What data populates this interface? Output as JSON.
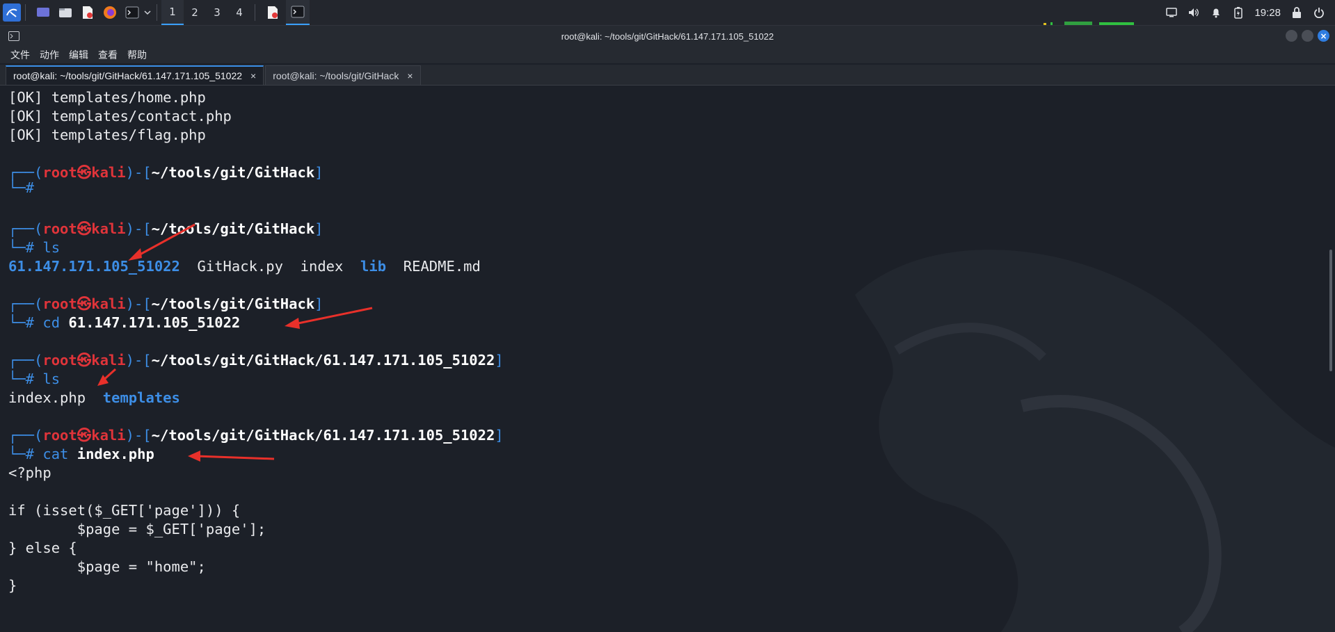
{
  "taskbar": {
    "workspaces": [
      "1",
      "2",
      "3",
      "4"
    ],
    "active_workspace": "1",
    "clock": "19:28",
    "icons": [
      "kali-menu-icon",
      "desktop-icon",
      "file-manager-icon",
      "text-editor-icon",
      "firefox-icon",
      "terminal-icon",
      "dropdown-icon"
    ],
    "tray_icons": [
      "display-icon",
      "volume-icon",
      "notification-bell-icon",
      "battery-icon",
      "lock-icon",
      "power-icon"
    ]
  },
  "window": {
    "title": "root@kali: ~/tools/git/GitHack/61.147.171.105_51022"
  },
  "menu": [
    "文件",
    "动作",
    "编辑",
    "查看",
    "帮助"
  ],
  "tabs": [
    {
      "label": "root@kali: ~/tools/git/GitHack/61.147.171.105_51022",
      "close": "×"
    },
    {
      "label": "root@kali: ~/tools/git/GitHack",
      "close": "×"
    }
  ],
  "terminal": {
    "ok1": "[OK] templates/home.php",
    "ok2": "[OK] templates/contact.php",
    "ok3": "[OK] templates/flag.php",
    "prompt_open": "┌──(",
    "prompt_user": "root㉿kali",
    "prompt_mid": ")-[",
    "prompt_close": "]",
    "prompt_hash": "└─#",
    "path_githack": "~/tools/git/GitHack",
    "path_target": "~/tools/git/GitHack/61.147.171.105_51022",
    "cmd_ls": "ls",
    "cmd_cd": "cd",
    "cmd_cd_arg": "61.147.171.105_51022",
    "cmd_cat": "cat",
    "cmd_cat_arg": "index.php",
    "ls1_dir1": "61.147.171.105_51022",
    "ls1_f1": "GitHack.py",
    "ls1_f2": "index",
    "ls1_dir2": "lib",
    "ls1_f3": "README.md",
    "ls2_f1": "index.php",
    "ls2_dir1": "templates",
    "code": [
      "<?php",
      "",
      "if (isset($_GET['page'])) {",
      "        $page = $_GET['page'];",
      "} else {",
      "        $page = \"home\";",
      "}"
    ]
  },
  "colors": {
    "prompt_blue": "#3d8ee6",
    "prompt_red": "#e0343a",
    "background": "#1c2028",
    "annotation_arrow": "#e8302a"
  }
}
